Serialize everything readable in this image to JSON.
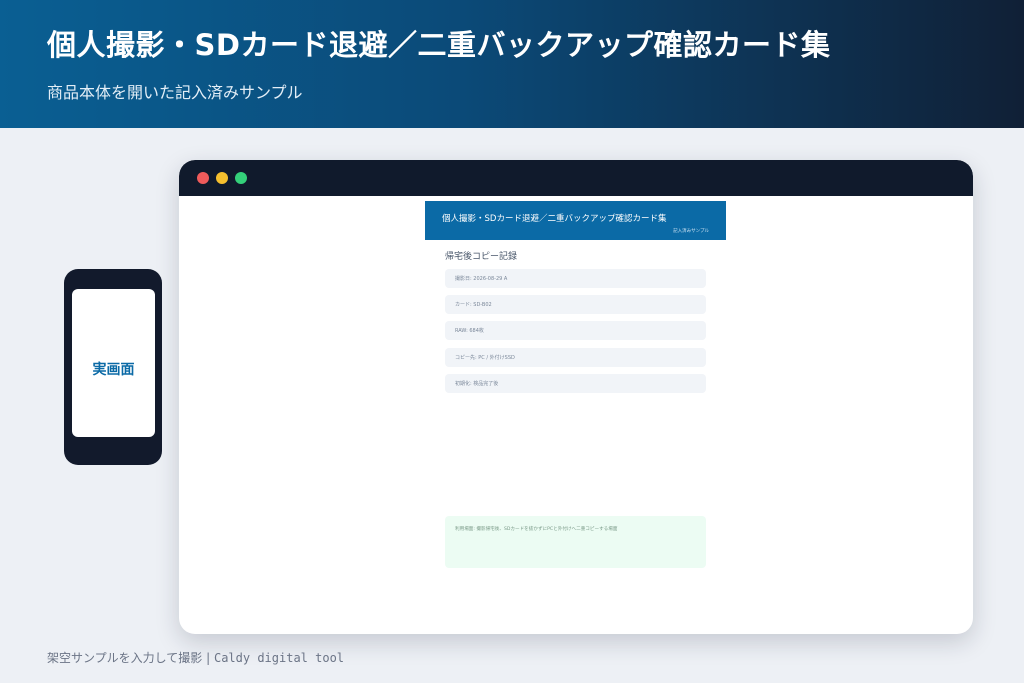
{
  "hero": {
    "title": "個人撮影・SDカード退避／二重バックアップ確認カード集",
    "subtitle": "商品本体を開いた記入済みサンプル"
  },
  "window": {
    "app_title": "個人撮影・SDカード退避／二重バックアップ確認カード集",
    "app_subtitle": "記入済みサンプル",
    "section_title": "帰宅後コピー記録",
    "fields": [
      "撮影日: 2026-08-29 A",
      "カード: SD-B02",
      "RAW: 684枚",
      "コピー先: PC / 外付けSSD",
      "初期化: 検品完了後"
    ],
    "note": "利用場面: 撮影帰宅後、SDカードを抜かずにPCと外付けへ二重コピーする場面"
  },
  "phone": {
    "label": "実画面"
  },
  "footer": {
    "caption": "架空サンプルを入力して撮影",
    "separator": "|",
    "brand": "Caldy digital tool"
  }
}
